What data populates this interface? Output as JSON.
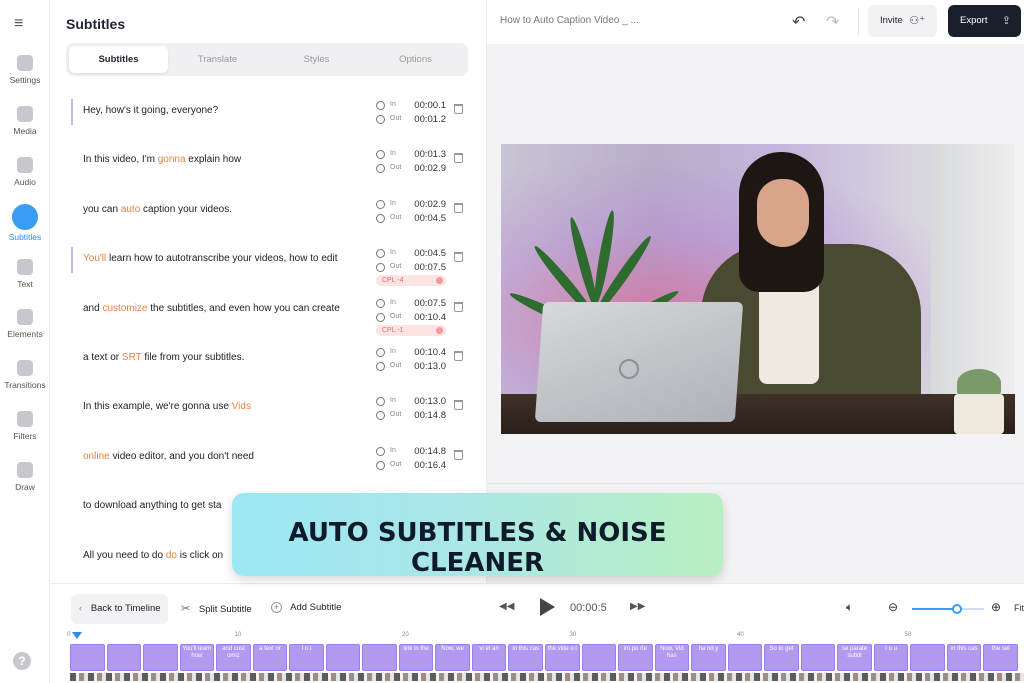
{
  "rail": {
    "items": [
      {
        "label": "Settings",
        "icon": "gear-icon"
      },
      {
        "label": "Media",
        "icon": "plus-icon"
      },
      {
        "label": "Audio",
        "icon": "music-note-icon"
      },
      {
        "label": "Subtitles",
        "icon": "subtitles-icon"
      },
      {
        "label": "Text",
        "icon": "text-icon"
      },
      {
        "label": "Elements",
        "icon": "elements-icon"
      },
      {
        "label": "Transitions",
        "icon": "transitions-icon"
      },
      {
        "label": "Filters",
        "icon": "filters-icon"
      },
      {
        "label": "Draw",
        "icon": "pencil-icon"
      }
    ],
    "active": "Subtitles",
    "help": "?"
  },
  "panel": {
    "title": "Subtitles",
    "tabs": [
      "Subtitles",
      "Translate",
      "Styles",
      "Options"
    ],
    "active_tab": "Subtitles",
    "rows": [
      {
        "pre": "Hey, how's it going, everyone?",
        "hl": "",
        "post": "",
        "in": "00:00.1",
        "out": "00:01.2",
        "cpl": ""
      },
      {
        "pre": "In this video, I'm ",
        "hl": "gonna",
        "post": " explain how",
        "in": "00:01.3",
        "out": "00:02.9",
        "cpl": ""
      },
      {
        "pre": "you can ",
        "hl": "auto",
        "post": " caption your videos.",
        "in": "00:02.9",
        "out": "00:04.5",
        "cpl": ""
      },
      {
        "pre": "",
        "hl": "You'll",
        "post": " learn how to autotranscribe your videos, how to edit",
        "in": "00:04.5",
        "out": "00:07.5",
        "cpl": "CPL  -4"
      },
      {
        "pre": "and ",
        "hl": "customize",
        "post": " the subtitles, and even how you can create",
        "in": "00:07.5",
        "out": "00:10.4",
        "cpl": "CPL  -1"
      },
      {
        "pre": "a text or ",
        "hl": "SRT",
        "post": " file from your subtitles.",
        "in": "00:10.4",
        "out": "00:13.0",
        "cpl": ""
      },
      {
        "pre": "In this example, we're gonna use ",
        "hl": "Vids",
        "post": "",
        "in": "00:13.0",
        "out": "00:14.8",
        "cpl": ""
      },
      {
        "pre": "",
        "hl": "online",
        "post": " video editor, and you don't need",
        "in": "00:14.8",
        "out": "00:16.4",
        "cpl": ""
      },
      {
        "pre": "to download anything to get sta",
        "hl": "",
        "post": "",
        "in": "",
        "out": "",
        "cpl": ""
      },
      {
        "pre": "All you need to do ",
        "hl": "do",
        "post": " is click on",
        "in": "",
        "out": "",
        "cpl": ""
      }
    ],
    "in_label": "In",
    "out_label": "Out"
  },
  "topbar": {
    "title": "How to Auto Caption Video _ ...",
    "invite": "Invite",
    "export": "Export"
  },
  "banner": "AUTO SUBTITLES & NOISE CLEANER",
  "controls": {
    "back": "Back to Timeline",
    "split": "Split Subtitle",
    "add": "Add Subtitle",
    "time": "00:00:5",
    "fit": "Fit",
    "zoom_level": 0.62
  },
  "timeline": {
    "ticks": [
      "0",
      "10",
      "20",
      "30",
      "40",
      "50"
    ],
    "clips": [
      "",
      "",
      "",
      "You'll learn how",
      "and cust omiz",
      "a text or",
      "I n t",
      "",
      "",
      "link in the",
      "Now, we",
      "vi et an",
      "in this cas",
      "the vide o l",
      "",
      "im po rte",
      "Now, Vid has",
      "ha nd y",
      "",
      "So to get",
      "",
      "se parate subtit",
      "I o u",
      "",
      "in this cas",
      "the sel"
    ]
  },
  "colors": {
    "accent": "#3b9cf3",
    "highlight": "#f0803c",
    "clip": "#b19af0",
    "export_bg": "#1a1f2c"
  }
}
